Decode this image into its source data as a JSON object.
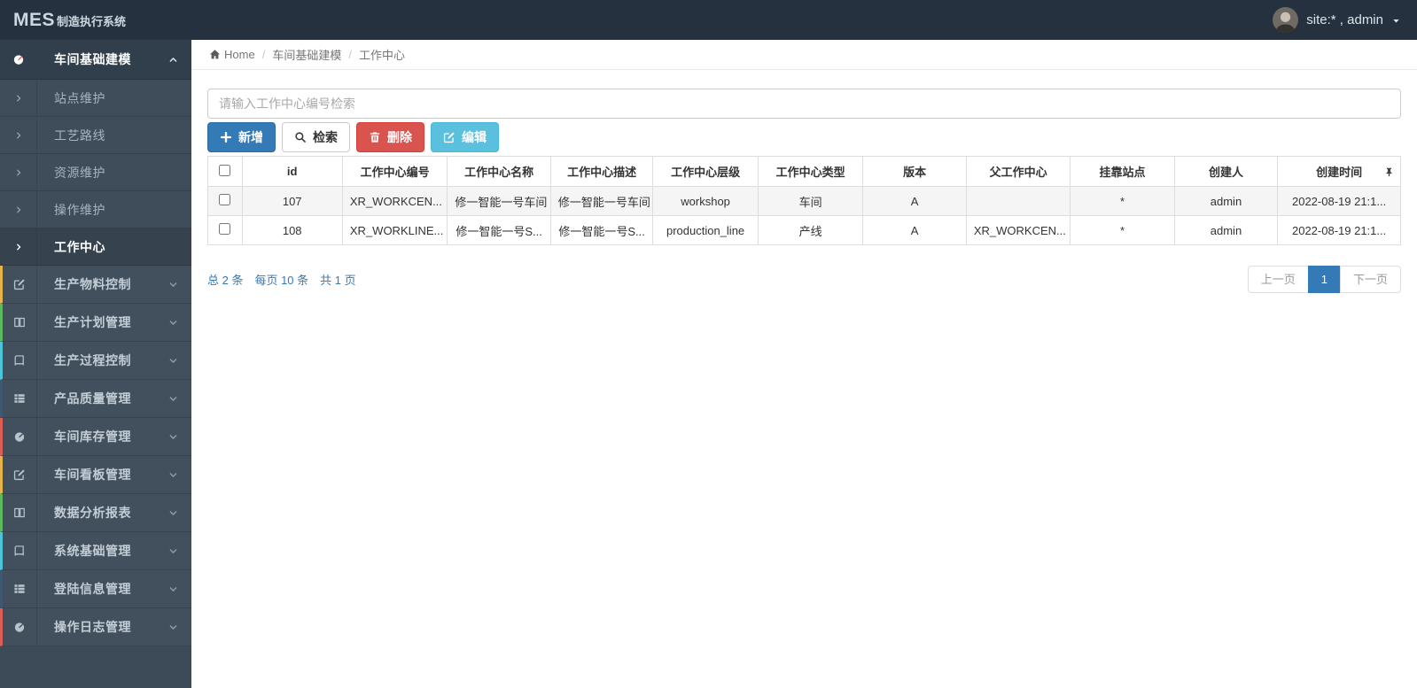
{
  "topbar": {
    "brand_bold": "MES",
    "brand_rest": "制造执行系统",
    "user": "site:* , admin"
  },
  "colors": {
    "topbar_bg": "#263140",
    "sidebar_bg": "#3d4a57",
    "active_icon_bg": "#ef6352",
    "primary": "#337ab7",
    "danger": "#d9534f",
    "info": "#5bc0de",
    "stripe_cycle": [
      "#e4b34a",
      "#5cb85c",
      "#4fc3d7",
      "#3f5872",
      "#e05d55"
    ]
  },
  "sidebar": {
    "parent": {
      "id": "workshop-modeling",
      "label": "车间基础建模",
      "icon": "gauge",
      "children": [
        {
          "id": "site-maintenance",
          "label": "站点维护",
          "active": false
        },
        {
          "id": "process-route",
          "label": "工艺路线",
          "active": false
        },
        {
          "id": "resource-maintenance",
          "label": "资源维护",
          "active": false
        },
        {
          "id": "operation-maintenance",
          "label": "操作维护",
          "active": false
        },
        {
          "id": "work-center",
          "label": "工作中心",
          "active": true
        }
      ]
    },
    "items": [
      {
        "id": "material-control",
        "label": "生产物料控制",
        "icon": "pencil",
        "stripe": "#e4b34a"
      },
      {
        "id": "plan-management",
        "label": "生产计划管理",
        "icon": "columns",
        "stripe": "#5cb85c"
      },
      {
        "id": "process-control",
        "label": "生产过程控制",
        "icon": "book",
        "stripe": "#4fc3d7"
      },
      {
        "id": "quality-management",
        "label": "产品质量管理",
        "icon": "thlist",
        "stripe": "#3f5872"
      },
      {
        "id": "inventory-management",
        "label": "车间库存管理",
        "icon": "gauge",
        "stripe": "#e05d55"
      },
      {
        "id": "kanban-management",
        "label": "车间看板管理",
        "icon": "pencil",
        "stripe": "#e4b34a"
      },
      {
        "id": "data-analysis-reports",
        "label": "数据分析报表",
        "icon": "columns",
        "stripe": "#5cb85c"
      },
      {
        "id": "system-base-management",
        "label": "系统基础管理",
        "icon": "book",
        "stripe": "#4fc3d7"
      },
      {
        "id": "login-info-management",
        "label": "登陆信息管理",
        "icon": "thlist",
        "stripe": "#3f5872"
      },
      {
        "id": "operation-log-management",
        "label": "操作日志管理",
        "icon": "gauge",
        "stripe": "#e05d55"
      }
    ]
  },
  "breadcrumb": {
    "items": [
      "Home",
      "车间基础建模",
      "工作中心"
    ]
  },
  "search": {
    "placeholder": "请输入工作中心编号检索"
  },
  "toolbar": {
    "add_label": "新增",
    "search_label": "检索",
    "delete_label": "删除",
    "edit_label": "编辑"
  },
  "table": {
    "headers": [
      "id",
      "工作中心编号",
      "工作中心名称",
      "工作中心描述",
      "工作中心层级",
      "工作中心类型",
      "版本",
      "父工作中心",
      "挂靠站点",
      "创建人",
      "创建时间"
    ],
    "rows": [
      [
        "107",
        "XR_WORKCEN...",
        "修一智能一号车间",
        "修一智能一号车间",
        "workshop",
        "车间",
        "A",
        "",
        "*",
        "admin",
        "2022-08-19 21:1..."
      ],
      [
        "108",
        "XR_WORKLINE...",
        "修一智能一号S...",
        "修一智能一号S...",
        "production_line",
        "产线",
        "A",
        "XR_WORKCEN...",
        "*",
        "admin",
        "2022-08-19 21:1..."
      ]
    ]
  },
  "summary": {
    "total": "总 2 条",
    "page_size": "每页 10 条",
    "page_count": "共 1 页"
  },
  "pagination": {
    "prev": "上一页",
    "current": "1",
    "next": "下一页"
  }
}
